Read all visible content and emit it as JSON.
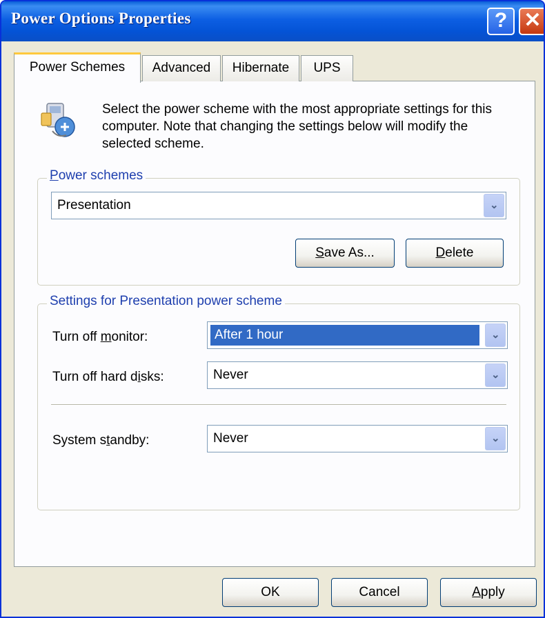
{
  "window": {
    "title": "Power Options Properties"
  },
  "titlebar": {
    "help_glyph": "?",
    "close_glyph": "✕"
  },
  "tabs": [
    {
      "label": "Power Schemes",
      "active": true
    },
    {
      "label": "Advanced",
      "active": false
    },
    {
      "label": "Hibernate",
      "active": false
    },
    {
      "label": "UPS",
      "active": false
    }
  ],
  "description": "Select the power scheme with the most appropriate settings for this computer. Note that changing the settings below will modify the selected scheme.",
  "power_schemes": {
    "group_label": {
      "pre": "",
      "accel": "P",
      "post": "ower schemes"
    },
    "selected": "Presentation",
    "save_as": {
      "accel": "S",
      "post": "ave As..."
    },
    "delete": {
      "accel": "D",
      "post": "elete"
    }
  },
  "settings": {
    "group_label": "Settings for Presentation power scheme",
    "monitor": {
      "label_pre": "Turn off ",
      "accel": "m",
      "label_post": "onitor:",
      "value": "After 1 hour"
    },
    "hard_disks": {
      "label_pre": "Turn off hard d",
      "accel": "i",
      "label_post": "sks:",
      "value": "Never"
    },
    "standby": {
      "label_pre": "System s",
      "accel": "t",
      "label_post": "andby:",
      "value": "Never"
    }
  },
  "footer": {
    "ok": "OK",
    "cancel": "Cancel",
    "apply": {
      "accel": "A",
      "post": "pply"
    }
  },
  "colors": {
    "titlebar": "#0453d6",
    "dialog_bg": "#ece9d8",
    "selection": "#316ac5",
    "group_label": "#1e3fae"
  },
  "icons": {
    "dialog": "power-options-icon",
    "combo_arrow": "chevron-down-icon"
  }
}
